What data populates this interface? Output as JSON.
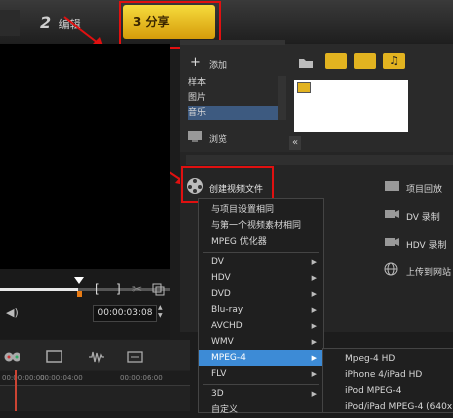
{
  "tabs": {
    "edit": {
      "num": "2",
      "label": "编辑"
    },
    "share": {
      "num": "3",
      "label": "分享"
    }
  },
  "library": {
    "add_label": "添加",
    "items": [
      "样本",
      "图片",
      "音乐"
    ],
    "browse_label": "浏览"
  },
  "share_panel": {
    "create_video": "创建视频文件",
    "actions": [
      "项目回放",
      "DV 录制",
      "HDV 录制",
      "上传到网站"
    ]
  },
  "menu": {
    "items": [
      {
        "label": "与项目设置相同",
        "arrow": ""
      },
      {
        "label": "与第一个视频素材相同",
        "arrow": ""
      },
      {
        "label": "MPEG 优化器",
        "arrow": ""
      },
      {
        "label": "DV",
        "arrow": "▶"
      },
      {
        "label": "HDV",
        "arrow": "▶"
      },
      {
        "label": "DVD",
        "arrow": "▶"
      },
      {
        "label": "Blu-ray",
        "arrow": "▶"
      },
      {
        "label": "AVCHD",
        "arrow": "▶"
      },
      {
        "label": "WMV",
        "arrow": "▶"
      },
      {
        "label": "MPEG-4",
        "arrow": "▶"
      },
      {
        "label": "FLV",
        "arrow": "▶"
      },
      {
        "label": "3D",
        "arrow": "▶"
      },
      {
        "label": "自定义",
        "arrow": ""
      }
    ],
    "selected_index": 9
  },
  "submenu": {
    "items": [
      "Mpeg-4 HD",
      "iPhone 4/iPad HD",
      "iPod MPEG-4",
      "iPod/iPad MPEG-4 (640x"
    ]
  },
  "player": {
    "bracket_left": "[",
    "bracket_right": "]",
    "timecode": "00:00:03:08"
  },
  "timeline": {
    "ruler": [
      "00:00:00:00",
      "00:00:04:00",
      "00:00:06:00"
    ]
  },
  "colors": {
    "accent": "#f0c020",
    "highlight": "#3d8bd6",
    "annotation": "#e01010"
  }
}
